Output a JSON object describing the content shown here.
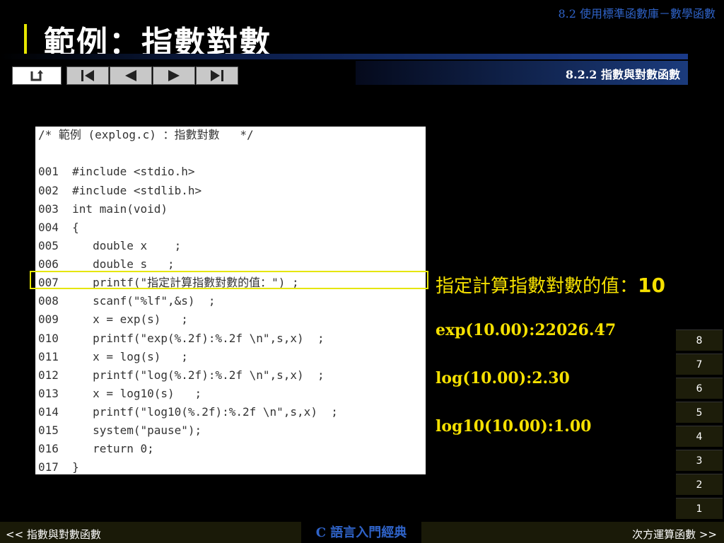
{
  "header": {
    "section": "8.2  使用標準函數庫－數學函數",
    "title": "範例：指數對數",
    "subsection": "8.2.2 指數與對數函數"
  },
  "nav_icons": [
    "return-icon",
    "first-icon",
    "prev-icon",
    "next-icon",
    "last-icon"
  ],
  "code": [
    "/* 範例 (explog.c) ：指數對數   */",
    "",
    "001  #include <stdio.h>",
    "002  #include <stdlib.h>",
    "003  int main(void)",
    "004  {",
    "005     double x    ;",
    "006     double s   ;",
    "007     printf(\"指定計算指數對數的值：\") ;",
    "008     scanf(\"%lf\",&s)  ;",
    "009     x = exp(s)   ;",
    "010     printf(\"exp(%.2f):%.2f \\n\",s,x)  ;",
    "011     x = log(s)   ;",
    "012     printf(\"log(%.2f):%.2f \\n\",s,x)  ;",
    "013     x = log10(s)   ;",
    "014     printf(\"log10(%.2f):%.2f \\n\",s,x)  ;",
    "015     system(\"pause\");",
    "016     return 0;",
    "017  }"
  ],
  "output": {
    "prompt": "指定計算指數對數的值：",
    "prompt_value": "10",
    "exp": "exp(10.00):22026.47",
    "log": "log(10.00):2.30",
    "log10": "log10(10.00):1.00"
  },
  "pages": [
    "8",
    "7",
    "6",
    "5",
    "4",
    "3",
    "2",
    "1"
  ],
  "footer": {
    "prev": "<< 指數與對數函數",
    "book": "C 語言入門經典",
    "next": "次方運算函數 >>"
  },
  "colors": {
    "accent_yellow": "#e6e600",
    "link_blue": "#2f63c8",
    "output_yellow": "#f5e000"
  }
}
